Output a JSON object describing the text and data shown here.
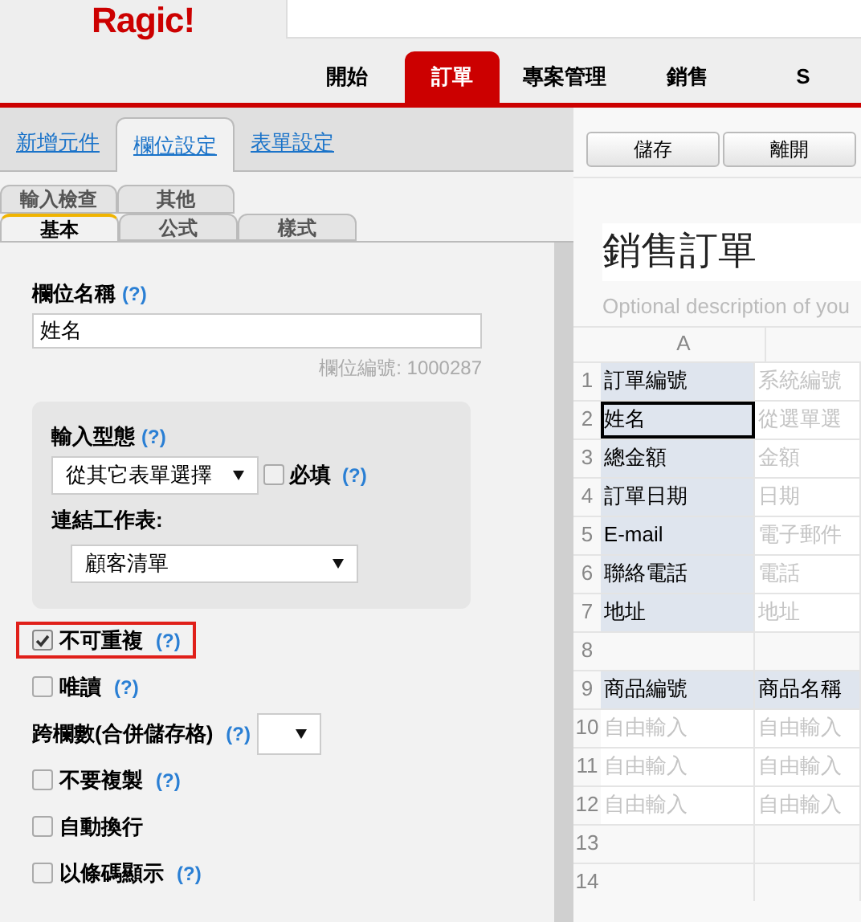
{
  "logo": "Ragic!",
  "nav_tabs": [
    {
      "label": "開始",
      "selected": false
    },
    {
      "label": "訂單",
      "selected": true
    },
    {
      "label": "專案管理",
      "selected": false
    },
    {
      "label": "銷售",
      "selected": false
    },
    {
      "label": "S",
      "selected": false
    }
  ],
  "panel_tabs": [
    {
      "label": "新增元件",
      "selected": false
    },
    {
      "label": "欄位設定",
      "selected": true
    },
    {
      "label": "表單設定",
      "selected": false
    }
  ],
  "sub_tabs_back": [
    {
      "label": "輸入檢查",
      "selected": false
    },
    {
      "label": "其他",
      "selected": false
    }
  ],
  "sub_tabs_front": [
    {
      "label": "基本",
      "selected": true
    },
    {
      "label": "公式",
      "selected": false
    },
    {
      "label": "樣式",
      "selected": false
    }
  ],
  "field_name": {
    "label": "欄位名稱",
    "help": "(?)",
    "value": "姓名",
    "field_id": "欄位編號: 1000287"
  },
  "input_type": {
    "label": "輸入型態",
    "help": "(?)",
    "value": "從其它表單選擇",
    "required": {
      "label": "必填",
      "help": "(?)",
      "checked": false
    },
    "link_label": "連結工作表:",
    "link_value": "顧客清單"
  },
  "options": [
    {
      "kind": "checkbox",
      "label": "不可重複",
      "help": "(?)",
      "checked": true,
      "highlighted": true
    },
    {
      "kind": "checkbox",
      "label": "唯讀",
      "help": "(?)",
      "checked": false,
      "highlighted": false
    },
    {
      "kind": "select",
      "label": "跨欄數(合併儲存格)",
      "help": "(?)",
      "highlighted": false
    },
    {
      "kind": "checkbox",
      "label": "不要複製",
      "help": "(?)",
      "checked": false,
      "highlighted": false
    },
    {
      "kind": "checkbox",
      "label": "自動換行",
      "checked": false,
      "highlighted": false
    },
    {
      "kind": "checkbox",
      "label": "以條碼顯示",
      "help": "(?)",
      "checked": false,
      "highlighted": false
    }
  ],
  "buttons": [
    "儲存",
    "離開"
  ],
  "form_title": "銷售訂單",
  "form_description": "Optional description of you",
  "sheet": {
    "column_header": "A",
    "rows": [
      {
        "number": "1",
        "cells": [
          {
            "text": "訂單編號",
            "kind": "label",
            "selected": false
          },
          {
            "text": "系統編號",
            "kind": "placeholder",
            "selected": false
          }
        ]
      },
      {
        "number": "2",
        "cells": [
          {
            "text": "姓名",
            "kind": "label",
            "selected": true
          },
          {
            "text": "從選單選",
            "kind": "placeholder",
            "selected": false
          }
        ]
      },
      {
        "number": "3",
        "cells": [
          {
            "text": "總金額",
            "kind": "label",
            "selected": false
          },
          {
            "text": "金額",
            "kind": "placeholder",
            "selected": false
          }
        ]
      },
      {
        "number": "4",
        "cells": [
          {
            "text": "訂單日期",
            "kind": "label",
            "selected": false
          },
          {
            "text": "日期",
            "kind": "placeholder",
            "selected": false
          }
        ]
      },
      {
        "number": "5",
        "cells": [
          {
            "text": "E-mail",
            "kind": "label",
            "selected": false
          },
          {
            "text": "電子郵件",
            "kind": "placeholder",
            "selected": false
          }
        ]
      },
      {
        "number": "6",
        "cells": [
          {
            "text": "聯絡電話",
            "kind": "label",
            "selected": false
          },
          {
            "text": "電話",
            "kind": "placeholder",
            "selected": false
          }
        ]
      },
      {
        "number": "7",
        "cells": [
          {
            "text": "地址",
            "kind": "label",
            "selected": false
          },
          {
            "text": "地址",
            "kind": "placeholder",
            "selected": false
          }
        ]
      },
      {
        "number": "8",
        "cells": []
      },
      {
        "number": "9",
        "cells": [
          {
            "text": "商品編號",
            "kind": "header",
            "selected": false
          },
          {
            "text": "商品名稱",
            "kind": "header",
            "selected": false
          }
        ]
      },
      {
        "number": "10",
        "cells": [
          {
            "text": "自由輸入",
            "kind": "placeholder",
            "selected": false
          },
          {
            "text": "自由輸入",
            "kind": "placeholder",
            "selected": false
          }
        ]
      },
      {
        "number": "11",
        "cells": [
          {
            "text": "自由輸入",
            "kind": "placeholder",
            "selected": false
          },
          {
            "text": "自由輸入",
            "kind": "placeholder",
            "selected": false
          }
        ]
      },
      {
        "number": "12",
        "cells": [
          {
            "text": "自由輸入",
            "kind": "placeholder",
            "selected": false
          },
          {
            "text": "自由輸入",
            "kind": "placeholder",
            "selected": false
          }
        ]
      },
      {
        "number": "13",
        "cells": []
      },
      {
        "number": "14",
        "cells": []
      }
    ]
  }
}
